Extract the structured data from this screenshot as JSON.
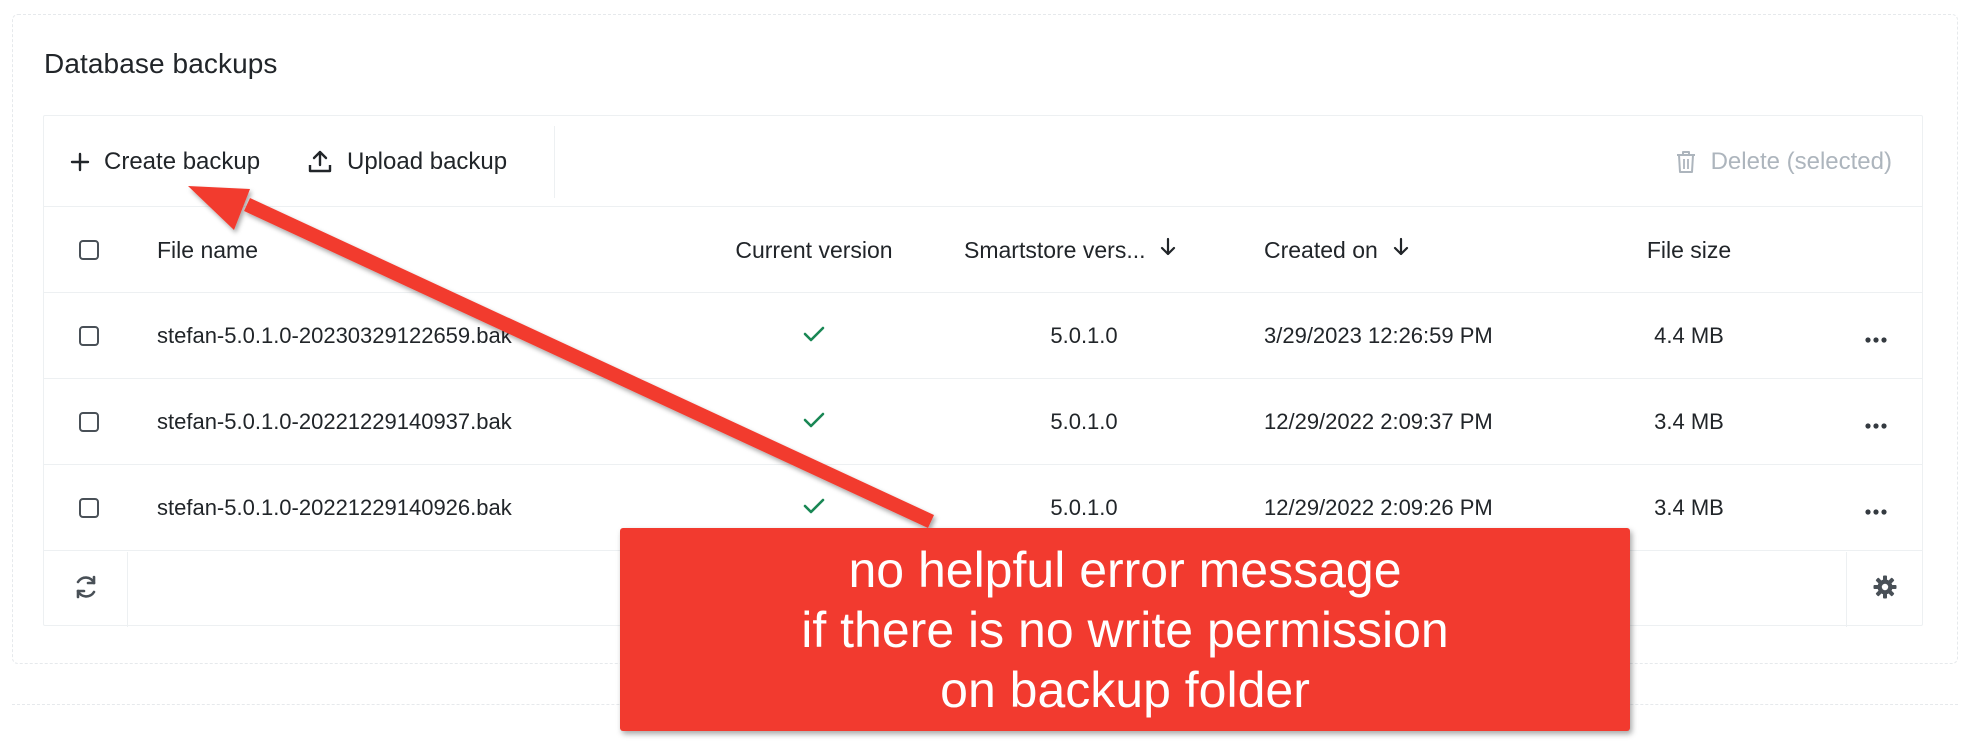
{
  "section": {
    "title": "Database backups"
  },
  "toolbar": {
    "create_label": "Create backup",
    "upload_label": "Upload backup",
    "delete_label": "Delete (selected)"
  },
  "table": {
    "columns": {
      "file_name": "File name",
      "current_version": "Current version",
      "smartstore_version": "Smartstore vers...",
      "created_on": "Created on",
      "file_size": "File size"
    },
    "rows": [
      {
        "file_name": "stefan-5.0.1.0-20230329122659.bak",
        "current": true,
        "version": "5.0.1.0",
        "created_on": "3/29/2023 12:26:59 PM",
        "file_size": "4.4 MB"
      },
      {
        "file_name": "stefan-5.0.1.0-20221229140937.bak",
        "current": true,
        "version": "5.0.1.0",
        "created_on": "12/29/2022 2:09:37 PM",
        "file_size": "3.4 MB"
      },
      {
        "file_name": "stefan-5.0.1.0-20221229140926.bak",
        "current": true,
        "version": "5.0.1.0",
        "created_on": "12/29/2022 2:09:26 PM",
        "file_size": "3.4 MB"
      }
    ]
  },
  "annotation": {
    "lines": [
      "no helpful error message",
      "if there is no write permission",
      "on backup folder"
    ]
  },
  "colors": {
    "accent_green": "#198754",
    "callout_red": "#f23a2f",
    "disabled_gray": "#adb5bd"
  },
  "icons": {
    "create": "plus-icon",
    "upload": "upload-icon",
    "delete": "trash-icon",
    "current": "check-icon",
    "row_actions": "more-dots-icon",
    "refresh": "refresh-icon",
    "settings": "gear-icon",
    "sort": "arrow-down-icon"
  }
}
